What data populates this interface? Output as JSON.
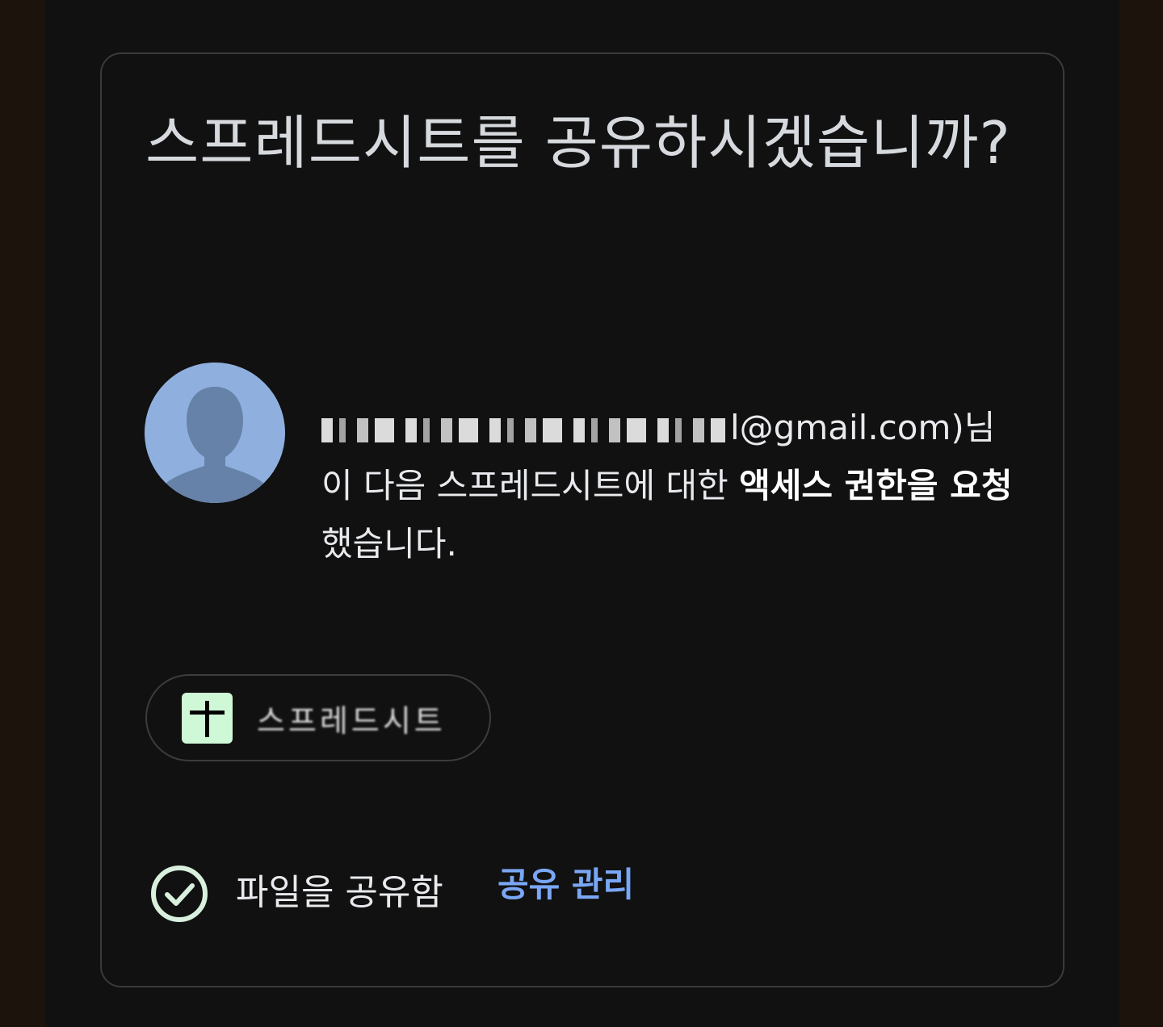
{
  "dialog": {
    "title": "스프레드시트를 공유하시겠습니까?"
  },
  "request": {
    "email_suffix": "l@gmail.com)님",
    "line_rest": "이 다음 스프레드시트에 대한 ",
    "bold_access": "액세스 권한을 요청",
    "tail": "했습니다."
  },
  "file": {
    "icon": "google-sheets-icon",
    "name": "스프레드시트"
  },
  "share_status": {
    "icon": "check-circle-icon",
    "label": "파일을 공유함",
    "manage_link": "공유 관리"
  },
  "colors": {
    "background": "#111111",
    "link": "#7aa7f5",
    "sheet_icon_bg": "#cff8d7",
    "avatar_bg": "#8fb0df"
  }
}
